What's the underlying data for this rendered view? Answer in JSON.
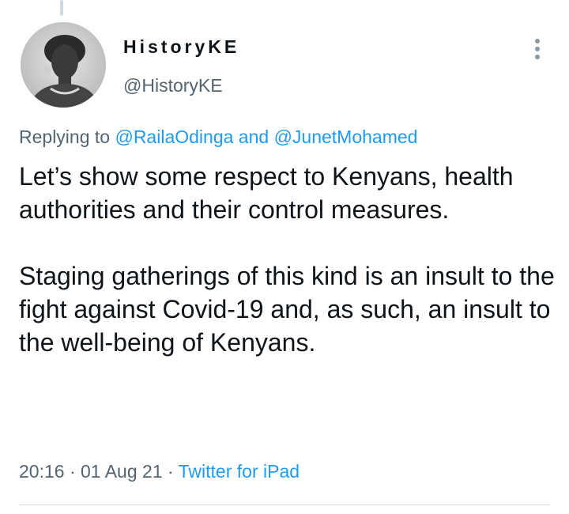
{
  "tweet": {
    "author": {
      "display_name": "HistoryKE",
      "handle": "@HistoryKE"
    },
    "reply": {
      "prefix": "Replying to ",
      "mention_1": "@RailaOdinga",
      "joiner": " and ",
      "mention_2": "@JunetMohamed"
    },
    "text": "Let’s show some respect to Kenyans, health authorities and their control measures.\n\nStaging gatherings of this kind is an insult to the fight against Covid-19 and, as such, an insult to the well-being of Kenyans.",
    "time": "20:16",
    "separator": " · ",
    "date": "01 Aug 21",
    "source": "Twitter for iPad"
  },
  "icons": {
    "more": "more-vertical-icon"
  },
  "colors": {
    "link": "#1d9bf0",
    "secondary_text": "#536471",
    "primary_text": "#0f1419",
    "divider": "#cfd9de"
  }
}
